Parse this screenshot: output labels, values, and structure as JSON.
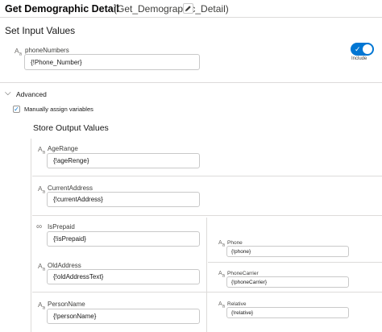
{
  "header": {
    "title": "Get Demographic Detail",
    "api_name": "(Get_Demographic_Detail)",
    "edit_icon": "pencil-icon"
  },
  "inputs_section": {
    "title": "Set Input Values",
    "field": {
      "type_icon": "Aa",
      "label": "phoneNumbers",
      "value": "{!Phone_Number}"
    },
    "toggle": {
      "on": true,
      "label": "Include"
    }
  },
  "advanced": {
    "label": "Advanced",
    "expanded": true,
    "manual_assign": {
      "checked": true,
      "label": "Manually assign variables"
    },
    "store_title": "Store Output Values",
    "left_fields": [
      {
        "type_icon": "Aa",
        "label": "AgeRange",
        "value": "{!ageRenge}"
      },
      {
        "type_icon": "Aa",
        "label": "CurrentAddress",
        "value": "{!currentAddress}"
      },
      {
        "type_icon": "∞",
        "label": "IsPrepaid",
        "value": "{!isPrepaid}"
      },
      {
        "type_icon": "Aa",
        "label": "OldAddress",
        "value": "{!oldAddressText}"
      },
      {
        "type_icon": "Aa",
        "label": "PersonName",
        "value": "{!personName}"
      }
    ],
    "right_fields": [
      {
        "type_icon": "Aa",
        "label": "Phone",
        "value": "{!phone}"
      },
      {
        "type_icon": "Aa",
        "label": "PhoneCarrier",
        "value": "{!phoneCarrier}"
      },
      {
        "type_icon": "Aa",
        "label": "Relative",
        "value": "{!relative}"
      }
    ]
  },
  "colors": {
    "brand": "#0176d3",
    "border": "#c9c9c9",
    "divider": "#dddbda"
  }
}
